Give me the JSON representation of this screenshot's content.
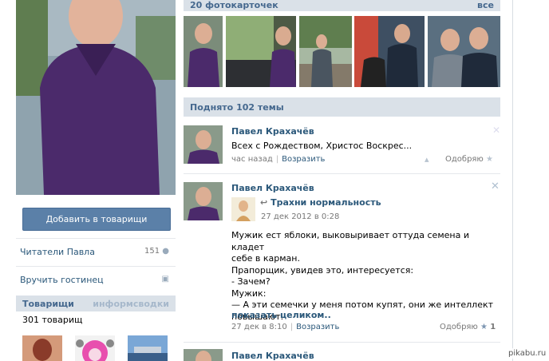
{
  "left": {
    "add_friend_button": "Добавить в товарищи",
    "readers_label": "Читатели Павла",
    "readers_count": "151",
    "gift_label": "Вручить гостинец",
    "friends_header": "Товарищи",
    "friends_header_right": "информсводки",
    "friends_count": "301 товарищ"
  },
  "photos": {
    "header": "20 фотокарточек",
    "all_link": "все"
  },
  "topics_header": "Поднято 102 темы",
  "posts": [
    {
      "author": "Павел Крахачёв",
      "text": "Всех с Рождеством, Христос Воскрес...",
      "time": "час назад",
      "action": "Возразить",
      "like_label": "Одобряю"
    },
    {
      "author": "Павел Крахачёв",
      "repost_group": "Трахни нормальность",
      "repost_date": "27 дек 2012 в 0:28",
      "lines": [
        "Мужик ест яблоки, выковыривает оттуда семена и кладет",
        "себе в карман.",
        "Прапорщик, увидев это, интересуется:",
        "- Зачем?",
        "Мужик:",
        "— А эти семечки у меня потом купят, они же интеллект",
        "повышают."
      ],
      "show_more": "показать целиком..",
      "time": "27 дек в 8:10",
      "action": "Возразить",
      "like_label": "Одобряю",
      "like_count": "1"
    },
    {
      "author": "Павел Крахачёв"
    }
  ],
  "watermark": "pikabu.ru"
}
